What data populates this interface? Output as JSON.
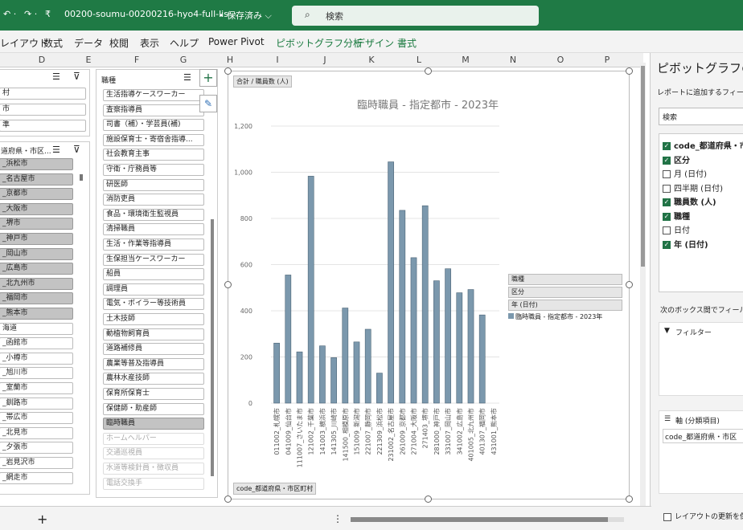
{
  "titlebar": {
    "undo": "↶ ·",
    "redo": "↷ ·",
    "qat": "₹",
    "filename": "00200-soumu-00200216-hyo4-full-lis···",
    "saved": "• 保存済み ⌵",
    "search": "検索"
  },
  "ribbon": {
    "tabs": [
      "レイアウト",
      "数式",
      "データ",
      "校閲",
      "表示",
      "ヘルプ",
      "Power Pivot",
      "ピボットグラフ分析",
      "デザイン",
      "書式"
    ]
  },
  "columns": [
    "D",
    "E",
    "F",
    "G",
    "H",
    "I",
    "J",
    "K",
    "L",
    "M",
    "N",
    "O",
    "P"
  ],
  "slicer1": {
    "items": [
      "村",
      "市",
      "準"
    ]
  },
  "slicer2": {
    "title": "道府県・市区...",
    "items": [
      "_浜松市",
      "_名古屋市",
      "_京都市",
      "_大阪市",
      "_堺市",
      "_神戸市",
      "_岡山市",
      "_広島市",
      "_北九州市",
      "_福岡市",
      "_熊本市",
      "海道",
      "_函館市",
      "_小樽市",
      "_旭川市",
      "_室蘭市",
      "_釧路市",
      "_帯広市",
      "_北見市",
      "_夕張市",
      "_岩見沢市",
      "_網走市"
    ]
  },
  "slicer3": {
    "title": "職種",
    "items": [
      "生活指導ケースワーカー",
      "査察指導員",
      "司書（補）・学芸員(補)",
      "施設保育士・寄宿舎指導...",
      "社会教育主事",
      "守衛・庁務員等",
      "研医師",
      "消防吏員",
      "食品・環境衛生監視員",
      "清掃職員",
      "生活・作業等指導員",
      "生保担当ケースワーカー",
      "船員",
      "調理員",
      "電気・ボイラー等技術員",
      "土木技師",
      "動植物飼育員",
      "道路補修員",
      "農業等普及指導員",
      "農林水産技師",
      "保育所保育士",
      "保健師・助産師",
      "臨時職員",
      "ホームヘルパー",
      "交通巡視員",
      "水道等検針員・徴収員",
      "電話交換手"
    ],
    "selected_index": 22,
    "disabled_from": 23
  },
  "chart": {
    "value_label": "合計 / 職員数 (人)",
    "axis_field": "code_都道府県・市区町村",
    "legend_fields": [
      "職種",
      "区分",
      "年 (日付)"
    ],
    "legend_entry": "臨時職員 - 指定都市 - 2023年",
    "series_color": "#7b98ad"
  },
  "chart_data": {
    "type": "bar",
    "title": "臨時職員 - 指定都市 - 2023年",
    "ylim": [
      0,
      1200
    ],
    "yticks": [
      "0",
      "200",
      "400",
      "600",
      "800",
      "1,000",
      "1,200"
    ],
    "categories": [
      "011002_札幌市",
      "041009_仙台市",
      "111007_さいたま市",
      "121002_千葉市",
      "141003_横浜市",
      "141305_川崎市",
      "141500_相模原市",
      "151009_新潟市",
      "221007_静岡市",
      "221309_浜松市",
      "231002_名古屋市",
      "261009_京都市",
      "271004_大阪市",
      "271403_堺市",
      "281000_神戸市",
      "331007_岡山市",
      "341002_広島市",
      "401005_北九州市",
      "401307_福岡市",
      "431001_熊本市"
    ],
    "values": [
      260,
      555,
      222,
      983,
      248,
      197,
      412,
      265,
      320,
      130,
      1045,
      835,
      630,
      855,
      530,
      582,
      478,
      492,
      382
    ]
  },
  "pane": {
    "title": "ピボットグラフの",
    "subtitle": "レポートに追加するフィール",
    "search": "検索",
    "fields": [
      {
        "label": "code_都道府県・市",
        "checked": true
      },
      {
        "label": "区分",
        "checked": true
      },
      {
        "label": "月 (日付)",
        "checked": false
      },
      {
        "label": "四半期 (日付)",
        "checked": false
      },
      {
        "label": "職員数 (人)",
        "checked": true
      },
      {
        "label": "職種",
        "checked": true
      },
      {
        "label": "日付",
        "checked": false
      },
      {
        "label": "年 (日付)",
        "checked": true
      }
    ],
    "drag_hint": "次のボックス間でフィールド",
    "filter_label": "フィルター",
    "axis_label": "軸 (分類項目)",
    "axis_value": "code_都道府県・市区",
    "defer_label": "レイアウトの更新を保"
  },
  "statusbar": {
    "add": "+",
    "more": "⋮"
  },
  "colors": {
    "brand": "#1f7a45",
    "bar": "#7b98ad"
  }
}
